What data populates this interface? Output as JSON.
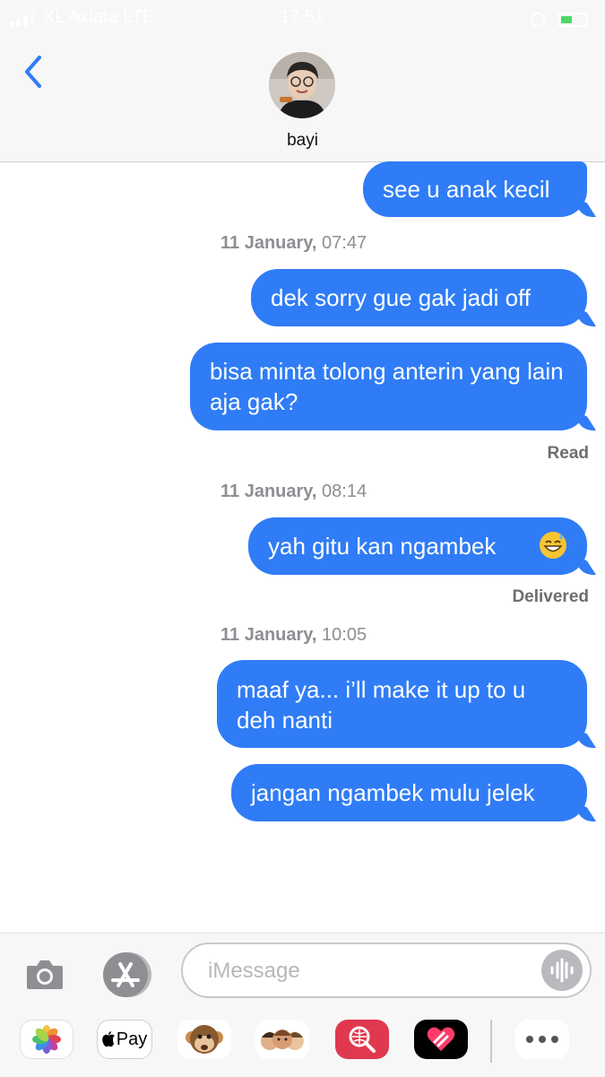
{
  "status_bar": {
    "carrier": "XL Axiata  LTE",
    "time": "17.51"
  },
  "contact": {
    "name": "bayi"
  },
  "messages": [
    {
      "text": "see u anak kecil"
    },
    {
      "text": "dek sorry gue gak jadi off"
    },
    {
      "text": "bisa minta tolong anterin yang lain aja gak?"
    },
    {
      "text": "yah gitu kan ngambek"
    },
    {
      "text": "maaf ya... i’ll make it up to u deh nanti"
    },
    {
      "text": "jangan ngambek mulu jelek"
    }
  ],
  "timestamps": [
    {
      "date": "11 January,",
      "time": "07:47"
    },
    {
      "date": "11 January,",
      "time": "08:14"
    },
    {
      "date": "11 January,",
      "time": "10:05"
    }
  ],
  "receipts": {
    "read": "Read",
    "delivered": "Delivered"
  },
  "input": {
    "placeholder": "iMessage"
  },
  "app_drawer": {
    "apple_pay_label": "Pay",
    "icons": [
      "photos-icon",
      "apple-pay-icon",
      "monkey-memoji-icon",
      "memoji-stickers-icon",
      "image-search-icon",
      "digital-touch-icon",
      "more-icon"
    ]
  },
  "colors": {
    "bubble": "#2f7cf6",
    "accent": "#2f7cf6",
    "header_bg": "#f7f7f7",
    "timestamp": "#8e8e93"
  }
}
